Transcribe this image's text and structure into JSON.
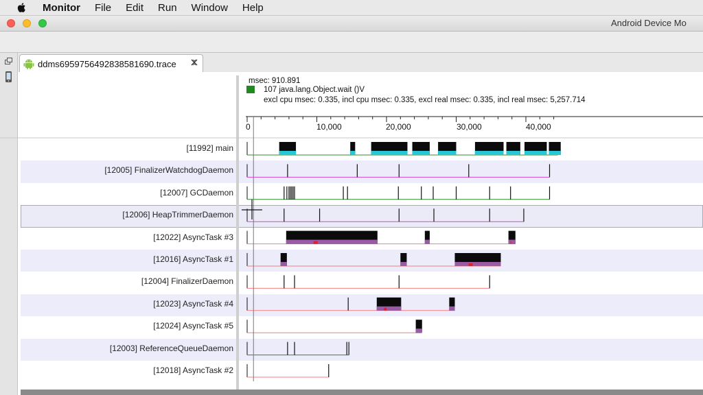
{
  "menubar": {
    "app_name": "Monitor",
    "items": [
      "File",
      "Edit",
      "Run",
      "Window",
      "Help"
    ]
  },
  "window": {
    "title": "Android Device Mo"
  },
  "editor_tab": {
    "label": "ddms6959756492838581690.trace",
    "icon": "android-icon"
  },
  "info_panel": {
    "msec": "msec: 910.891",
    "method": "107 java.lang.Object.wait ()V",
    "method_color": "#1f8a1f",
    "stats": "excl cpu msec: 0.335, incl cpu msec: 0.335, excl real msec: 0.335, incl real msec: 5,257.714"
  },
  "timescale": {
    "ticks": [
      "0",
      "10,000",
      "20,000",
      "30,000",
      "40,000"
    ]
  },
  "threads": [
    {
      "label": "[11992] main",
      "line_color": "#2e8b2e",
      "spans": [
        [
          0,
          44600
        ]
      ],
      "blocks": [
        [
          4600,
          7000
        ],
        [
          14800,
          15500
        ],
        [
          17800,
          23000
        ],
        [
          23700,
          26200
        ],
        [
          27400,
          30000
        ],
        [
          32700,
          36800
        ],
        [
          37200,
          39200
        ],
        [
          39800,
          43000
        ],
        [
          43300,
          45000
        ]
      ],
      "ticks": []
    },
    {
      "label": "[12005] FinalizerWatchdogDaemon",
      "line_color": "#d24bd2",
      "spans": [
        [
          0,
          43400
        ]
      ],
      "blocks": [],
      "ticks": [
        5800,
        15800,
        21800,
        31800,
        43400
      ]
    },
    {
      "label": "[12007] GCDaemon",
      "line_color": "#2e8b2e",
      "spans": [
        [
          0,
          43400
        ]
      ],
      "blocks": [],
      "ticks": [
        5300,
        5700,
        6000,
        6200,
        6400,
        6600,
        6800,
        13800,
        14400,
        21700,
        25000,
        26700,
        30000,
        34800,
        37800,
        43400
      ]
    },
    {
      "label": "[12006] HeapTrimmerDaemon",
      "line_color": "#d24bd2",
      "spans": [
        [
          0,
          39700
        ]
      ],
      "blocks": [],
      "ticks": [
        5300,
        10400,
        21800,
        26800,
        34800,
        39700
      ]
    },
    {
      "label": "[12022] AsyncTask #3",
      "line_color": "#f08080",
      "spans": [
        [
          0,
          38500
        ]
      ],
      "blocks": [
        [
          5600,
          18700
        ],
        [
          25500,
          26200
        ],
        [
          37500,
          38500
        ]
      ],
      "ticks": []
    },
    {
      "label": "[12016] AsyncTask #1",
      "line_color": "#f08080",
      "spans": [
        [
          0,
          36400
        ]
      ],
      "blocks": [
        [
          4800,
          5700
        ],
        [
          22000,
          22900
        ],
        [
          29800,
          36400
        ]
      ],
      "ticks": []
    },
    {
      "label": "[12004] FinalizerDaemon",
      "line_color": "#f08080",
      "spans": [
        [
          0,
          34800
        ]
      ],
      "blocks": [],
      "ticks": [
        5300,
        6800,
        21800,
        34800
      ]
    },
    {
      "label": "[12023] AsyncTask #4",
      "line_color": "#f08080",
      "spans": [
        [
          0,
          29800
        ]
      ],
      "blocks": [
        [
          18600,
          22100
        ],
        [
          29000,
          29800
        ]
      ],
      "ticks": [
        14500
      ]
    },
    {
      "label": "[12024] AsyncTask #5",
      "line_color": "#f08080",
      "spans": [
        [
          0,
          25000
        ]
      ],
      "blocks": [
        [
          24200,
          25100
        ]
      ],
      "ticks": []
    },
    {
      "label": "[12003] ReferenceQueueDaemon",
      "line_color": "#2e8b2e",
      "spans": [
        [
          0,
          14600
        ]
      ],
      "blocks": [],
      "ticks": [
        5800,
        6800,
        14300,
        14600
      ]
    },
    {
      "label": "[12018] AsyncTask #2",
      "line_color": "#f08080",
      "spans": [
        [
          0,
          11700
        ]
      ],
      "blocks": [],
      "ticks": [
        11700
      ]
    }
  ],
  "selected_thread": "[12006] HeapTrimmerDaemon",
  "cursor_time": 910.891
}
